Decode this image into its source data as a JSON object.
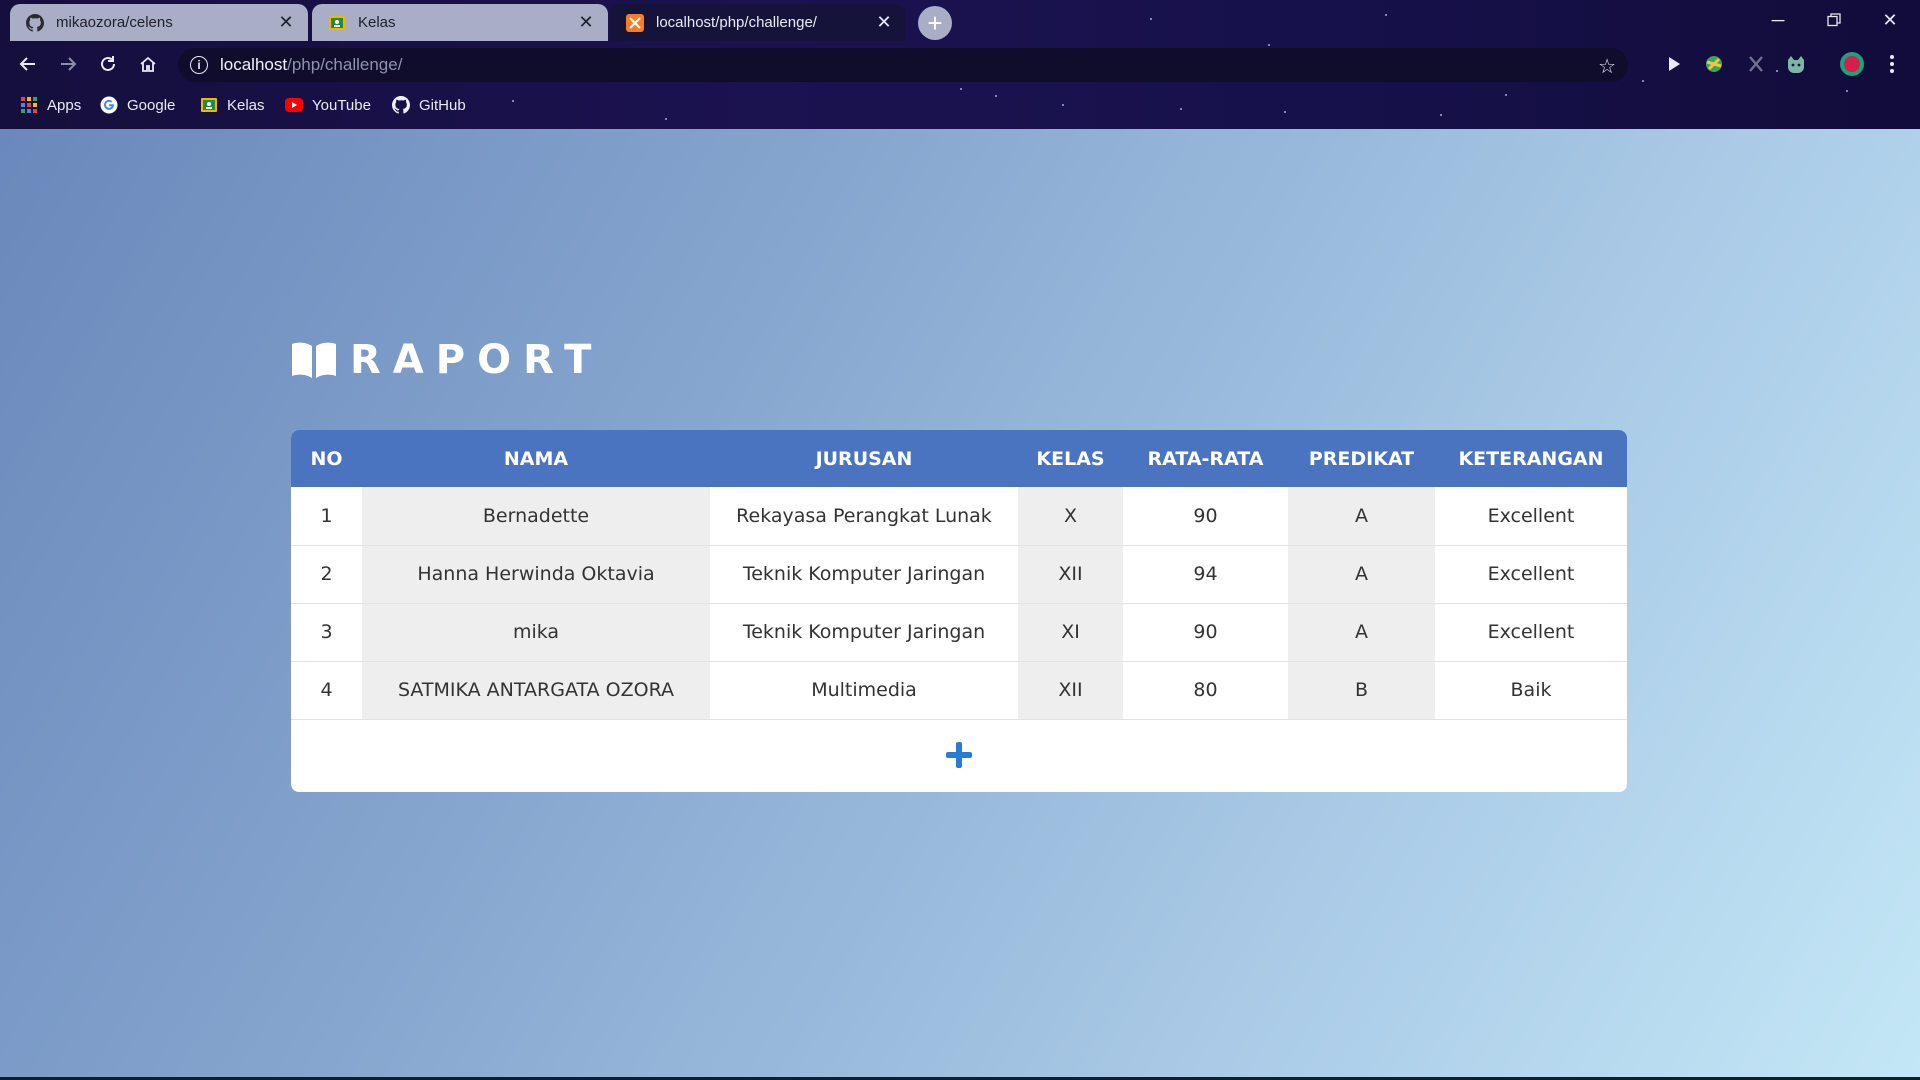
{
  "browser": {
    "tabs": [
      {
        "label": "mikaozora/celens",
        "icon": "github-icon",
        "active": false
      },
      {
        "label": "Kelas",
        "icon": "classroom-icon",
        "active": false
      },
      {
        "label": "localhost/php/challenge/",
        "icon": "xampp-icon",
        "active": true
      }
    ],
    "address": {
      "host": "localhost",
      "path": "/php/challenge/"
    },
    "bookmarks": [
      {
        "label": "Apps",
        "icon": "apps-grid-icon"
      },
      {
        "label": "Google",
        "icon": "google-icon"
      },
      {
        "label": "Kelas",
        "icon": "classroom-icon"
      },
      {
        "label": "YouTube",
        "icon": "youtube-icon"
      },
      {
        "label": "GitHub",
        "icon": "github-icon"
      }
    ]
  },
  "page": {
    "title": "RAPORT",
    "title_icon": "open-book-icon",
    "table": {
      "headers": [
        "NO",
        "NAMA",
        "JURUSAN",
        "KELAS",
        "RATA-RATA",
        "PREDIKAT",
        "KETERANGAN"
      ],
      "rows": [
        [
          "1",
          "Bernadette",
          "Rekayasa Perangkat Lunak",
          "X",
          "90",
          "A",
          "Excellent"
        ],
        [
          "2",
          "Hanna Herwinda Oktavia",
          "Teknik Komputer Jaringan",
          "XII",
          "94",
          "A",
          "Excellent"
        ],
        [
          "3",
          "mika",
          "Teknik Komputer Jaringan",
          "XI",
          "90",
          "A",
          "Excellent"
        ],
        [
          "4",
          "SATMIKA ANTARGATA OZORA",
          "Multimedia",
          "XII",
          "80",
          "B",
          "Baik"
        ]
      ]
    },
    "add_icon": "plus-icon",
    "colors": {
      "header": "#4a74c0",
      "add_button": "#2a7bd6"
    }
  }
}
